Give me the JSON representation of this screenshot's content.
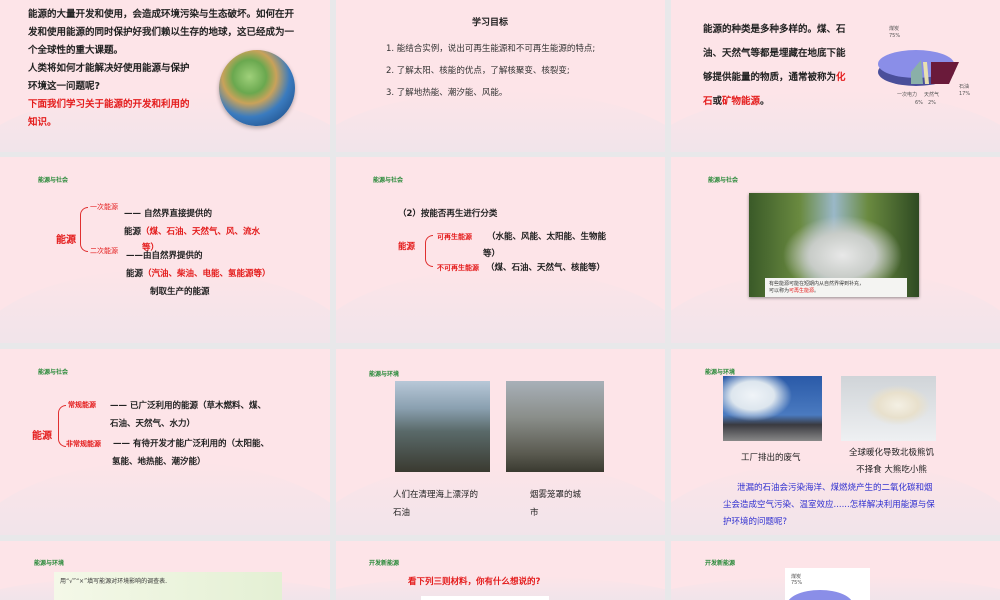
{
  "slides": [
    {
      "intro_lines": [
        "能源的大量开发和使用，会造成环境污染与生态破坏。如何在开",
        "发和使用能源的同时保护好我们赖以生存的地球，这已经成为一",
        "个全球性的重大课题。",
        "人类将如何才能解决好使用能源与保护",
        "环境这一问题呢?"
      ],
      "red_lines": [
        "下面我们学习关于能源的开发和利用的",
        "知识。"
      ]
    },
    {
      "title": "学习目标",
      "items": [
        "1. 能结合实例，说出可再生能源和不可再生能源的特点;",
        "2. 了解太阳、核能的优点，了解核聚变、核裂变;",
        "3. 了解地热能、潮汐能、风能。"
      ]
    },
    {
      "lines": [
        "能源的种类是多种多样的。煤、石",
        "油、天然气等都是埋藏在地底下能",
        "够提供能量的物质，通常被称为"
      ],
      "red1": "化",
      "red2": "石",
      "or": "或",
      "red3": "矿物能源",
      "end": "。",
      "pie": {
        "labels": [
          "煤炭",
          "石油",
          "一次电力",
          "天然气"
        ],
        "values": [
          "75%",
          "17%",
          "6%",
          "2%"
        ]
      }
    },
    {
      "tag": "能源与社会",
      "root": "能源",
      "b1": "一次能源",
      "b2": "二次能源",
      "d1a": "—— 自然界直接提供的",
      "d1b": "能源",
      "d1c": "（煤、石油、天然气、风、流水",
      "d1d": "等）",
      "d2a": "——由自然界提供的",
      "d2b": "能源",
      "d2c": "（汽油、柴油、电能、氢能源等）",
      "d2d": "制取生产的能源"
    },
    {
      "tag": "能源与社会",
      "heading": "（2）按能否再生进行分类",
      "root": "能源",
      "b1": "可再生能源",
      "d1": "（水能、风能、太阳能、生物能",
      "d1b": "等）",
      "b2": "不可再生能源",
      "d2": "（煤、石油、天然气、核能等）"
    },
    {
      "tag": "能源与社会",
      "caption1": "有些能源可能在短期内从自然界得到补充，",
      "caption2": "可以称为",
      "caption_red": "可再生能源",
      "caption_end": "。"
    },
    {
      "tag": "能源与社会",
      "root": "能源",
      "b1": "常规能源",
      "d1a": "—— 已广泛利用的能源（草木燃料、煤、",
      "d1b": "石油、天然气、水力）",
      "b2": "非常规能源",
      "d2a": "—— 有待开发才能广泛利用的（太阳能、",
      "d2b": "氢能、地热能、潮汐能）"
    },
    {
      "tag": "能源与环境",
      "cap1a": "人们在清理海上漂浮的",
      "cap1b": "石油",
      "cap2a": "烟雾笼罩的城",
      "cap2b": "市"
    },
    {
      "tag": "能源与环境",
      "cap1": "工厂排出的废气",
      "cap2a": "全球暖化导致北极熊饥",
      "cap2b": "不择食 大熊吃小熊",
      "para": [
        "泄漏的石油会污染海洋、煤燃烧产生的二氧化碳和烟",
        "尘会造成空气污染、温室效应......怎样解决利用能源与保",
        "护环境的问题呢?"
      ]
    },
    {
      "tag": "能源与环境",
      "text": "用“√”“×”填写能源对环境影响的调查表."
    },
    {
      "tag": "开发新能源",
      "text": "看下列三则材料，你有什么想说的?"
    },
    {
      "tag": "开发新能源",
      "pie_label": "煤炭",
      "pie_value": "75%"
    }
  ]
}
